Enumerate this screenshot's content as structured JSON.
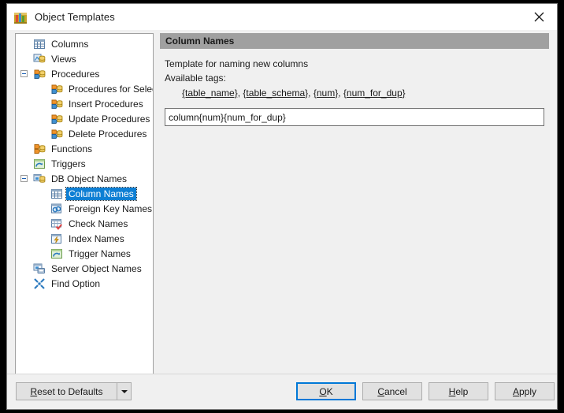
{
  "window": {
    "title": "Object Templates",
    "icon": "object-templates-icon",
    "close_label": "✕"
  },
  "tree": {
    "items": [
      {
        "label": "Columns",
        "icon": "table-icon",
        "level": 0,
        "expander": "none",
        "selected": false
      },
      {
        "label": "Views",
        "icon": "view-icon",
        "level": 0,
        "expander": "none",
        "selected": false
      },
      {
        "label": "Procedures",
        "icon": "procedure-icon",
        "level": 0,
        "expander": "collapse",
        "selected": false
      },
      {
        "label": "Procedures for Select",
        "icon": "procedure-icon",
        "level": 1,
        "expander": "none",
        "selected": false
      },
      {
        "label": "Insert Procedures",
        "icon": "procedure-icon",
        "level": 1,
        "expander": "none",
        "selected": false
      },
      {
        "label": "Update Procedures",
        "icon": "procedure-icon",
        "level": 1,
        "expander": "none",
        "selected": false
      },
      {
        "label": "Delete Procedures",
        "icon": "procedure-icon",
        "level": 1,
        "expander": "none",
        "selected": false
      },
      {
        "label": "Functions",
        "icon": "function-icon",
        "level": 0,
        "expander": "none",
        "selected": false
      },
      {
        "label": "Triggers",
        "icon": "trigger-icon",
        "level": 0,
        "expander": "none",
        "selected": false
      },
      {
        "label": "DB Object Names",
        "icon": "db-object-icon",
        "level": 0,
        "expander": "collapse",
        "selected": false
      },
      {
        "label": "Column Names",
        "icon": "table-icon",
        "level": 1,
        "expander": "none",
        "selected": true
      },
      {
        "label": "Foreign Key Names",
        "icon": "foreign-key-icon",
        "level": 1,
        "expander": "none",
        "selected": false
      },
      {
        "label": "Check Names",
        "icon": "check-icon",
        "level": 1,
        "expander": "none",
        "selected": false
      },
      {
        "label": "Index Names",
        "icon": "index-icon",
        "level": 1,
        "expander": "none",
        "selected": false
      },
      {
        "label": "Trigger Names",
        "icon": "trigger-icon",
        "level": 1,
        "expander": "none",
        "selected": false
      },
      {
        "label": "Server Object Names",
        "icon": "server-object-icon",
        "level": 0,
        "expander": "none",
        "selected": false
      },
      {
        "label": "Find Option",
        "icon": "find-option-icon",
        "level": 0,
        "expander": "none",
        "selected": false
      }
    ]
  },
  "panel": {
    "header": "Column Names",
    "description": "Template for naming new columns",
    "tags_label": "Available tags:",
    "tags": [
      "{table_name}",
      "{table_schema}",
      "{num}",
      "{num_for_dup}"
    ],
    "tag_separator": ",",
    "template_value": "column{num}{num_for_dup}"
  },
  "footer": {
    "reset_label_pre": "R",
    "reset_label_post": "eset to Defaults",
    "reset_dropdown": "dropdown-arrow",
    "ok_pre": "O",
    "ok_post": "K",
    "cancel_pre": "C",
    "cancel_post": "ancel",
    "help_pre": "H",
    "help_post": "elp",
    "apply_pre": "A",
    "apply_post": "pply"
  },
  "colors": {
    "selection": "#0e7fd4",
    "panel_header": "#a0a0a0",
    "dialog_bg": "#f0f0f0",
    "focus_ring": "#0078d7"
  }
}
